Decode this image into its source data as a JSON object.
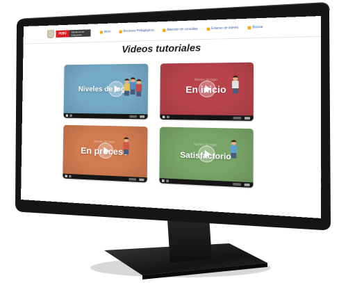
{
  "header": {
    "logo_country": "PERÚ",
    "logo_ministry": "Ministerio de Educación",
    "nav": [
      {
        "label": "Inicio",
        "icon": "home-icon"
      },
      {
        "label": "Recursos Pedagógicos",
        "icon": "book-icon"
      },
      {
        "label": "Atención de consultas",
        "icon": "question-icon"
      },
      {
        "label": "Enlaces de interés",
        "icon": "link-icon"
      },
      {
        "label": "Buscar",
        "icon": "search-icon"
      }
    ]
  },
  "page_title": "Videos tutoriales",
  "videos": [
    {
      "label": "Niveles de logro",
      "subtitle": "",
      "color": "#74a9c6"
    },
    {
      "label": "En inicio",
      "subtitle": "Niveles de logro",
      "color": "#b8434b"
    },
    {
      "label": "En proceso",
      "subtitle": "Niveles de logro",
      "color": "#d17b51"
    },
    {
      "label": "Satisfactorio",
      "subtitle": "Niveles de logro",
      "color": "#78a467"
    }
  ],
  "colors": {
    "bezel": "#151515",
    "nav_link": "#2d5aa0",
    "nav_icon": "#f0a81e",
    "logo_red": "#d91a21"
  }
}
